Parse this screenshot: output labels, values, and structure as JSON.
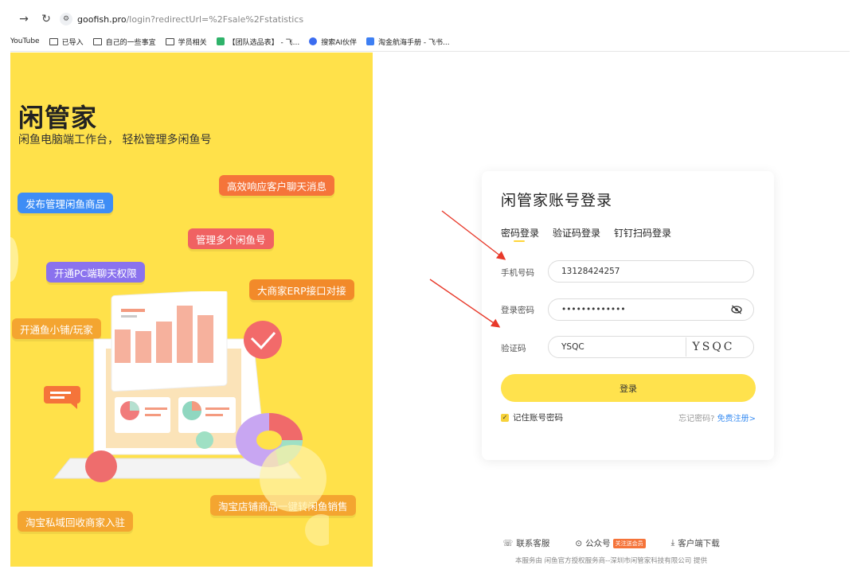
{
  "browser": {
    "url_host": "goofish.pro",
    "url_path": "/login?redirectUrl=%2Fsale%2Fstatistics",
    "bookmarks": [
      "YouTube",
      "已导入",
      "自己的一些事宜",
      "学员相关",
      "【团队选品表】 - 飞...",
      "搜索AI伙伴",
      "淘金航海手册 - 飞书..."
    ]
  },
  "promo": {
    "brand": "闲管家",
    "subtitle": "闲鱼电脑端工作台， 轻松管理多闲鱼号",
    "features": [
      "高效响应客户聊天消息",
      "发布管理闲鱼商品",
      "管理多个闲鱼号",
      "开通PC端聊天权限",
      "大商家ERP接口对接",
      "开通鱼小铺/玩家",
      "淘宝店铺商品一键转闲鱼销售",
      "淘宝私域回收商家入驻"
    ]
  },
  "login": {
    "title": "闲管家账号登录",
    "tabs": [
      "密码登录",
      "验证码登录",
      "钉钉扫码登录"
    ],
    "phone_label": "手机号码",
    "phone_value": "13128424257",
    "password_label": "登录密码",
    "password_value": "•••••••••••••",
    "captcha_label": "验证码",
    "captcha_value": "YSQC",
    "captcha_image_text": "YSQC",
    "submit_label": "登录",
    "remember_label": "记住账号密码",
    "forgot_label": "忘记密码?",
    "register_label": "免费注册>"
  },
  "footer": {
    "support": "联系客服",
    "official": "公众号",
    "official_badge": "关注送会员",
    "download": "客户端下载",
    "copyright": "本服务由 闲鱼官方授权服务商--深圳市闲管家科技有限公司 提供"
  },
  "colors": {
    "accent_yellow": "#ffe14a",
    "register_blue": "#3d8ff2",
    "annotation_red": "#e8392a"
  }
}
